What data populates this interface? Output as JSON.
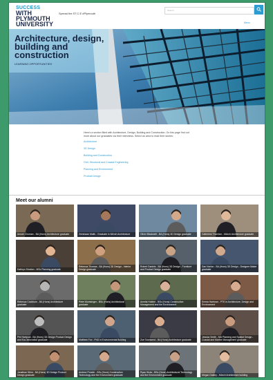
{
  "header": {
    "logo_line1": "SUCCESS",
    "logo_line2": "WITH",
    "logo_line3": "PLYMOUTH",
    "logo_line4": "UNIVERSITY",
    "tagline": "Spread the ST.C.E #Plymouth",
    "search_placeholder": "Search",
    "menu_link": "Menu"
  },
  "hero": {
    "title": "Architecture, design, building and construction",
    "subtitle": "LEARNING OPPORTUNITIES"
  },
  "intro": {
    "paragraph": "Here's a section filled with Architecture, Design, Building and Construction. On this page find out more about our graduates via their interviews. Select an area to read their stories:",
    "links": [
      "Architecture",
      "3D Design",
      "Building and Construction",
      "Civil, Structural and Coastal Engineering",
      "Planning and Environment",
      "Product Design"
    ]
  },
  "section_title": "Meet our alumni",
  "alumni": [
    {
      "caption": "Annah Chuman - BA (Hons) Architecture graduate",
      "bg": "#7a6a55",
      "skin": "#c99a7e"
    },
    {
      "caption": "Zeeshaan Malik - Graduate in MArch Architecture",
      "bg": "#3e4a66",
      "skin": "#a6785b"
    },
    {
      "caption": "Oliver Blackwell - BA (Hons) 3D Design graduate",
      "bg": "#6f8aa0",
      "skin": "#d4a98a"
    },
    {
      "caption": "Catherine Thornton - MArch Architecture graduate",
      "bg": "#9d8f7c",
      "skin": "#e0b89a"
    },
    {
      "caption": "Kathryn Stratton - MSc Planning graduate",
      "bg": "#4a4038",
      "skin": "#e2b693"
    },
    {
      "caption": "Rebecca Thomas - BA (Hons) 3D Design - Interior Design graduate",
      "bg": "#8c6e4b",
      "skin": "#cfa080"
    },
    {
      "caption": "Robert Daniels - BA (Hons) 3D Design - Furniture and Product Design graduate",
      "bg": "#56606a",
      "skin": "#c9a386"
    },
    {
      "caption": "Dan Norton - BA (Hons) 3D Design - Designer Maker graduate",
      "bg": "#46566e",
      "skin": "#d1a98d"
    },
    {
      "caption": "Rebecca Cockburn - BA (Hons) Architecture graduate",
      "bg": "#6b6b6b",
      "skin": "#b5b5b5"
    },
    {
      "caption": "Peter Muntsinger - BSc (Hons) Architectural graduate",
      "bg": "#6d7f5c",
      "skin": "#c4977a"
    },
    {
      "caption": "Amelia Holden - BSc (Hons) Construction Management and the Environment",
      "bg": "#5d6a4e",
      "skin": "#d9b199"
    },
    {
      "caption": "Emma Hartman - PTE in Architecture, Design and Environment",
      "bg": "#7c5a45",
      "skin": "#d7ab8f"
    },
    {
      "caption": "Phil Hartpool - BA (Hons) 3D Design Product Design and Eco-Innovation graduate",
      "bg": "#545454",
      "skin": "#bdbdbd"
    },
    {
      "caption": "Matthew Fox - PhD in Environmental Building",
      "bg": "#4d6072",
      "skin": "#d0a58b"
    },
    {
      "caption": "Zoe Townsend - BA (Hons) Architecture graduate",
      "bg": "#3b3b46",
      "skin": "#d9ad90"
    },
    {
      "caption": "Jessica Smith - MA Planning and Spatial Design - Coastal and Marine Management graduate",
      "bg": "#5e5048",
      "skin": "#c99c80"
    },
    {
      "caption": "Jonathan Stirm - BA (Hons) 3D Design Product Design graduate",
      "bg": "#7b6752",
      "skin": "#c09070"
    },
    {
      "caption": "Andrew Ponder - BSc (Hons) Construction Technology and the Environment graduate",
      "bg": "#5a6b77",
      "skin": "#d4a88b"
    },
    {
      "caption": "Ryan Hicks - BSc (Hons) Architectural Technology and the Environment graduate",
      "bg": "#6c7379",
      "skin": "#c9a186"
    },
    {
      "caption": "Megan Oakley - MArch Architecture building",
      "bg": "#8c8478",
      "skin": "#e3bc9f"
    }
  ]
}
